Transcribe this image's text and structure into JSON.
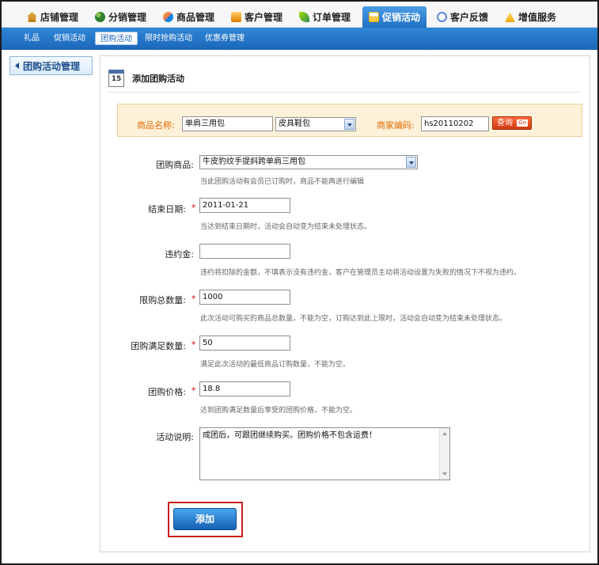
{
  "top_nav": [
    {
      "label": "店铺管理",
      "icon": "house-icon"
    },
    {
      "label": "分销管理",
      "icon": "people-icon"
    },
    {
      "label": "商品管理",
      "icon": "box-icon"
    },
    {
      "label": "客户管理",
      "icon": "card-icon"
    },
    {
      "label": "订单管理",
      "icon": "leaf-icon"
    },
    {
      "label": "促销活动",
      "icon": "gift-icon"
    },
    {
      "label": "客户反馈",
      "icon": "bubble-icon"
    },
    {
      "label": "增值服务",
      "icon": "value-icon"
    }
  ],
  "sub_nav": [
    "礼品",
    "促销活动",
    "团购活动",
    "限时抢购活动",
    "优惠券管理"
  ],
  "sidebar": {
    "label": "团购活动管理"
  },
  "panel": {
    "title": "添加团购活动",
    "calendar_number": "15"
  },
  "search": {
    "product_name_label": "商品名称:",
    "product_name_value": "单肩三用包",
    "category_value": "皮具鞋包",
    "merchant_code_label": "商家编码:",
    "merchant_code_value": "hs20110202",
    "query_label": "查询",
    "go_label": "Go"
  },
  "form": {
    "product": {
      "label": "团购商品:",
      "value": "牛皮豹纹手提斜跨单肩三用包",
      "hint": "当此团购活动有会员已订购时，商品不能再进行编辑"
    },
    "end_date": {
      "label": "结束日期:",
      "value": "2011-01-21",
      "hint": "当达到结束日期时，活动会自动变为结束未处理状态。"
    },
    "penalty": {
      "label": "违约金:",
      "value": "",
      "hint": "违约将扣除的金额，不填表示没有违约金，客户在管理员主动将活动设置为失败的情况下不视为违约。"
    },
    "max_qty": {
      "label": "限购总数量:",
      "value": "1000",
      "hint": "此次活动可购买的商品总数量，不能为空，订购达到此上限时，活动会自动变为结束未处理状态。"
    },
    "min_qty": {
      "label": "团购满足数量:",
      "value": "50",
      "hint": "满足此次活动的最低商品订购数量，不能为空。"
    },
    "price": {
      "label": "团购价格:",
      "value": "18.8",
      "hint": "达到团购满足数量后享受的团购价格，不能为空。"
    },
    "description": {
      "label": "活动说明:",
      "value": "成团后，可跟团继续购买。团购价格不包含运费！"
    },
    "required_mark": "*"
  },
  "submit_label": "添加"
}
